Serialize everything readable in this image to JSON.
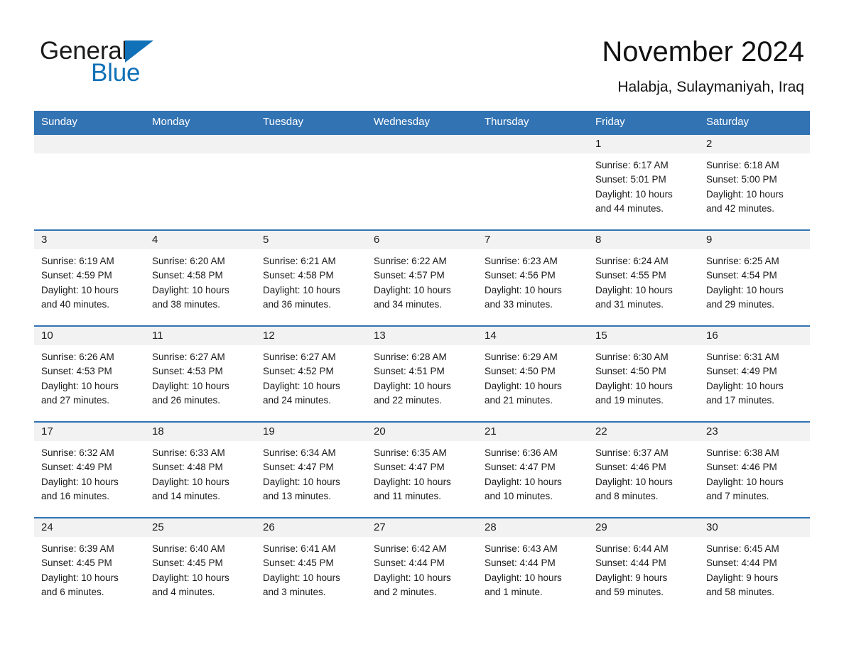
{
  "brand": {
    "name_part1": "General",
    "name_part2": "Blue",
    "triangle_color": "#1071b8"
  },
  "header": {
    "title": "November 2024",
    "subtitle": "Halabja, Sulaymaniyah, Iraq"
  },
  "theme": {
    "header_blue": "#3273b3",
    "row_divider_blue": "#3273b3",
    "date_band_gray": "#f2f2f2",
    "text_dark": "#1a1a1a"
  },
  "calendar": {
    "weekdays": [
      "Sunday",
      "Monday",
      "Tuesday",
      "Wednesday",
      "Thursday",
      "Friday",
      "Saturday"
    ],
    "weeks": [
      [
        {
          "day": "",
          "sunrise": "",
          "sunset": "",
          "daylight1": "",
          "daylight2": ""
        },
        {
          "day": "",
          "sunrise": "",
          "sunset": "",
          "daylight1": "",
          "daylight2": ""
        },
        {
          "day": "",
          "sunrise": "",
          "sunset": "",
          "daylight1": "",
          "daylight2": ""
        },
        {
          "day": "",
          "sunrise": "",
          "sunset": "",
          "daylight1": "",
          "daylight2": ""
        },
        {
          "day": "",
          "sunrise": "",
          "sunset": "",
          "daylight1": "",
          "daylight2": ""
        },
        {
          "day": "1",
          "sunrise": "Sunrise: 6:17 AM",
          "sunset": "Sunset: 5:01 PM",
          "daylight1": "Daylight: 10 hours",
          "daylight2": "and 44 minutes."
        },
        {
          "day": "2",
          "sunrise": "Sunrise: 6:18 AM",
          "sunset": "Sunset: 5:00 PM",
          "daylight1": "Daylight: 10 hours",
          "daylight2": "and 42 minutes."
        }
      ],
      [
        {
          "day": "3",
          "sunrise": "Sunrise: 6:19 AM",
          "sunset": "Sunset: 4:59 PM",
          "daylight1": "Daylight: 10 hours",
          "daylight2": "and 40 minutes."
        },
        {
          "day": "4",
          "sunrise": "Sunrise: 6:20 AM",
          "sunset": "Sunset: 4:58 PM",
          "daylight1": "Daylight: 10 hours",
          "daylight2": "and 38 minutes."
        },
        {
          "day": "5",
          "sunrise": "Sunrise: 6:21 AM",
          "sunset": "Sunset: 4:58 PM",
          "daylight1": "Daylight: 10 hours",
          "daylight2": "and 36 minutes."
        },
        {
          "day": "6",
          "sunrise": "Sunrise: 6:22 AM",
          "sunset": "Sunset: 4:57 PM",
          "daylight1": "Daylight: 10 hours",
          "daylight2": "and 34 minutes."
        },
        {
          "day": "7",
          "sunrise": "Sunrise: 6:23 AM",
          "sunset": "Sunset: 4:56 PM",
          "daylight1": "Daylight: 10 hours",
          "daylight2": "and 33 minutes."
        },
        {
          "day": "8",
          "sunrise": "Sunrise: 6:24 AM",
          "sunset": "Sunset: 4:55 PM",
          "daylight1": "Daylight: 10 hours",
          "daylight2": "and 31 minutes."
        },
        {
          "day": "9",
          "sunrise": "Sunrise: 6:25 AM",
          "sunset": "Sunset: 4:54 PM",
          "daylight1": "Daylight: 10 hours",
          "daylight2": "and 29 minutes."
        }
      ],
      [
        {
          "day": "10",
          "sunrise": "Sunrise: 6:26 AM",
          "sunset": "Sunset: 4:53 PM",
          "daylight1": "Daylight: 10 hours",
          "daylight2": "and 27 minutes."
        },
        {
          "day": "11",
          "sunrise": "Sunrise: 6:27 AM",
          "sunset": "Sunset: 4:53 PM",
          "daylight1": "Daylight: 10 hours",
          "daylight2": "and 26 minutes."
        },
        {
          "day": "12",
          "sunrise": "Sunrise: 6:27 AM",
          "sunset": "Sunset: 4:52 PM",
          "daylight1": "Daylight: 10 hours",
          "daylight2": "and 24 minutes."
        },
        {
          "day": "13",
          "sunrise": "Sunrise: 6:28 AM",
          "sunset": "Sunset: 4:51 PM",
          "daylight1": "Daylight: 10 hours",
          "daylight2": "and 22 minutes."
        },
        {
          "day": "14",
          "sunrise": "Sunrise: 6:29 AM",
          "sunset": "Sunset: 4:50 PM",
          "daylight1": "Daylight: 10 hours",
          "daylight2": "and 21 minutes."
        },
        {
          "day": "15",
          "sunrise": "Sunrise: 6:30 AM",
          "sunset": "Sunset: 4:50 PM",
          "daylight1": "Daylight: 10 hours",
          "daylight2": "and 19 minutes."
        },
        {
          "day": "16",
          "sunrise": "Sunrise: 6:31 AM",
          "sunset": "Sunset: 4:49 PM",
          "daylight1": "Daylight: 10 hours",
          "daylight2": "and 17 minutes."
        }
      ],
      [
        {
          "day": "17",
          "sunrise": "Sunrise: 6:32 AM",
          "sunset": "Sunset: 4:49 PM",
          "daylight1": "Daylight: 10 hours",
          "daylight2": "and 16 minutes."
        },
        {
          "day": "18",
          "sunrise": "Sunrise: 6:33 AM",
          "sunset": "Sunset: 4:48 PM",
          "daylight1": "Daylight: 10 hours",
          "daylight2": "and 14 minutes."
        },
        {
          "day": "19",
          "sunrise": "Sunrise: 6:34 AM",
          "sunset": "Sunset: 4:47 PM",
          "daylight1": "Daylight: 10 hours",
          "daylight2": "and 13 minutes."
        },
        {
          "day": "20",
          "sunrise": "Sunrise: 6:35 AM",
          "sunset": "Sunset: 4:47 PM",
          "daylight1": "Daylight: 10 hours",
          "daylight2": "and 11 minutes."
        },
        {
          "day": "21",
          "sunrise": "Sunrise: 6:36 AM",
          "sunset": "Sunset: 4:47 PM",
          "daylight1": "Daylight: 10 hours",
          "daylight2": "and 10 minutes."
        },
        {
          "day": "22",
          "sunrise": "Sunrise: 6:37 AM",
          "sunset": "Sunset: 4:46 PM",
          "daylight1": "Daylight: 10 hours",
          "daylight2": "and 8 minutes."
        },
        {
          "day": "23",
          "sunrise": "Sunrise: 6:38 AM",
          "sunset": "Sunset: 4:46 PM",
          "daylight1": "Daylight: 10 hours",
          "daylight2": "and 7 minutes."
        }
      ],
      [
        {
          "day": "24",
          "sunrise": "Sunrise: 6:39 AM",
          "sunset": "Sunset: 4:45 PM",
          "daylight1": "Daylight: 10 hours",
          "daylight2": "and 6 minutes."
        },
        {
          "day": "25",
          "sunrise": "Sunrise: 6:40 AM",
          "sunset": "Sunset: 4:45 PM",
          "daylight1": "Daylight: 10 hours",
          "daylight2": "and 4 minutes."
        },
        {
          "day": "26",
          "sunrise": "Sunrise: 6:41 AM",
          "sunset": "Sunset: 4:45 PM",
          "daylight1": "Daylight: 10 hours",
          "daylight2": "and 3 minutes."
        },
        {
          "day": "27",
          "sunrise": "Sunrise: 6:42 AM",
          "sunset": "Sunset: 4:44 PM",
          "daylight1": "Daylight: 10 hours",
          "daylight2": "and 2 minutes."
        },
        {
          "day": "28",
          "sunrise": "Sunrise: 6:43 AM",
          "sunset": "Sunset: 4:44 PM",
          "daylight1": "Daylight: 10 hours",
          "daylight2": "and 1 minute."
        },
        {
          "day": "29",
          "sunrise": "Sunrise: 6:44 AM",
          "sunset": "Sunset: 4:44 PM",
          "daylight1": "Daylight: 9 hours",
          "daylight2": "and 59 minutes."
        },
        {
          "day": "30",
          "sunrise": "Sunrise: 6:45 AM",
          "sunset": "Sunset: 4:44 PM",
          "daylight1": "Daylight: 9 hours",
          "daylight2": "and 58 minutes."
        }
      ]
    ]
  }
}
